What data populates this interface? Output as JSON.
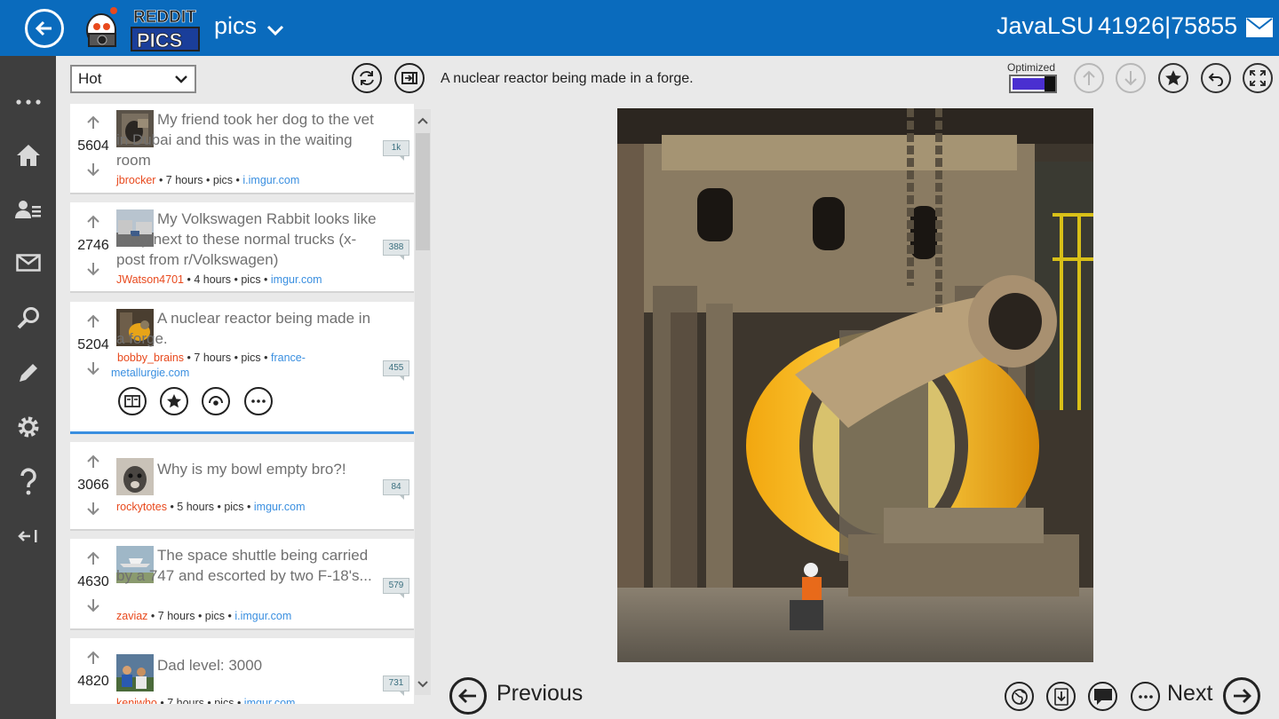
{
  "header": {
    "logo_text_top": "REDDIT",
    "logo_text_bottom": "PICS",
    "subreddit": "pics",
    "username": "JavaLSU",
    "karma": "41926|75855",
    "brand_color": "#0a6bbd"
  },
  "rail": {
    "items": [
      {
        "icon": "more-icon"
      },
      {
        "icon": "home-icon"
      },
      {
        "icon": "user-list-icon"
      },
      {
        "icon": "mail-icon"
      },
      {
        "icon": "search-icon"
      },
      {
        "icon": "pencil-icon"
      },
      {
        "icon": "gear-icon"
      },
      {
        "icon": "help-icon"
      },
      {
        "icon": "collapse-icon"
      }
    ]
  },
  "list": {
    "sort_value": "Hot",
    "posts": [
      {
        "score": "5604",
        "title": "My friend took her dog to the vet in Dubai and this was in the waiting room",
        "author": "jbrocker",
        "time": "7 hours",
        "sub": "pics",
        "domain": "i.imgur.com",
        "comments": "1k"
      },
      {
        "score": "2746",
        "title": "My Volkswagen Rabbit looks like a toy next to these normal trucks (x-post from r/Volkswagen)",
        "author": "JWatson4701",
        "time": "4 hours",
        "sub": "pics",
        "domain": "imgur.com",
        "comments": "388"
      },
      {
        "score": "5204",
        "title": "A nuclear reactor being made in a forge.",
        "author": "bobby_brains",
        "time": "7 hours",
        "sub": "pics",
        "domain": "france-metallurgie.com",
        "comments": "455"
      },
      {
        "score": "3066",
        "title": "Why is my bowl empty bro?!",
        "author": "rockytotes",
        "time": "5 hours",
        "sub": "pics",
        "domain": "imgur.com",
        "comments": "84"
      },
      {
        "score": "4630",
        "title": "The space shuttle being carried by a 747 and escorted by two F-18's...",
        "author": "zaviaz",
        "time": "7 hours",
        "sub": "pics",
        "domain": "i.imgur.com",
        "comments": "579"
      },
      {
        "score": "4820",
        "title": "Dad level: 3000",
        "author": "kenjwho",
        "time": "7 hours",
        "sub": "pics",
        "domain": "imgur.com",
        "comments": "731"
      }
    ]
  },
  "viewer": {
    "post_title": "A nuclear reactor being made in a forge.",
    "optimized_label": "Optimized",
    "optimized_on": true,
    "prev_label": "Previous",
    "next_label": "Next"
  }
}
